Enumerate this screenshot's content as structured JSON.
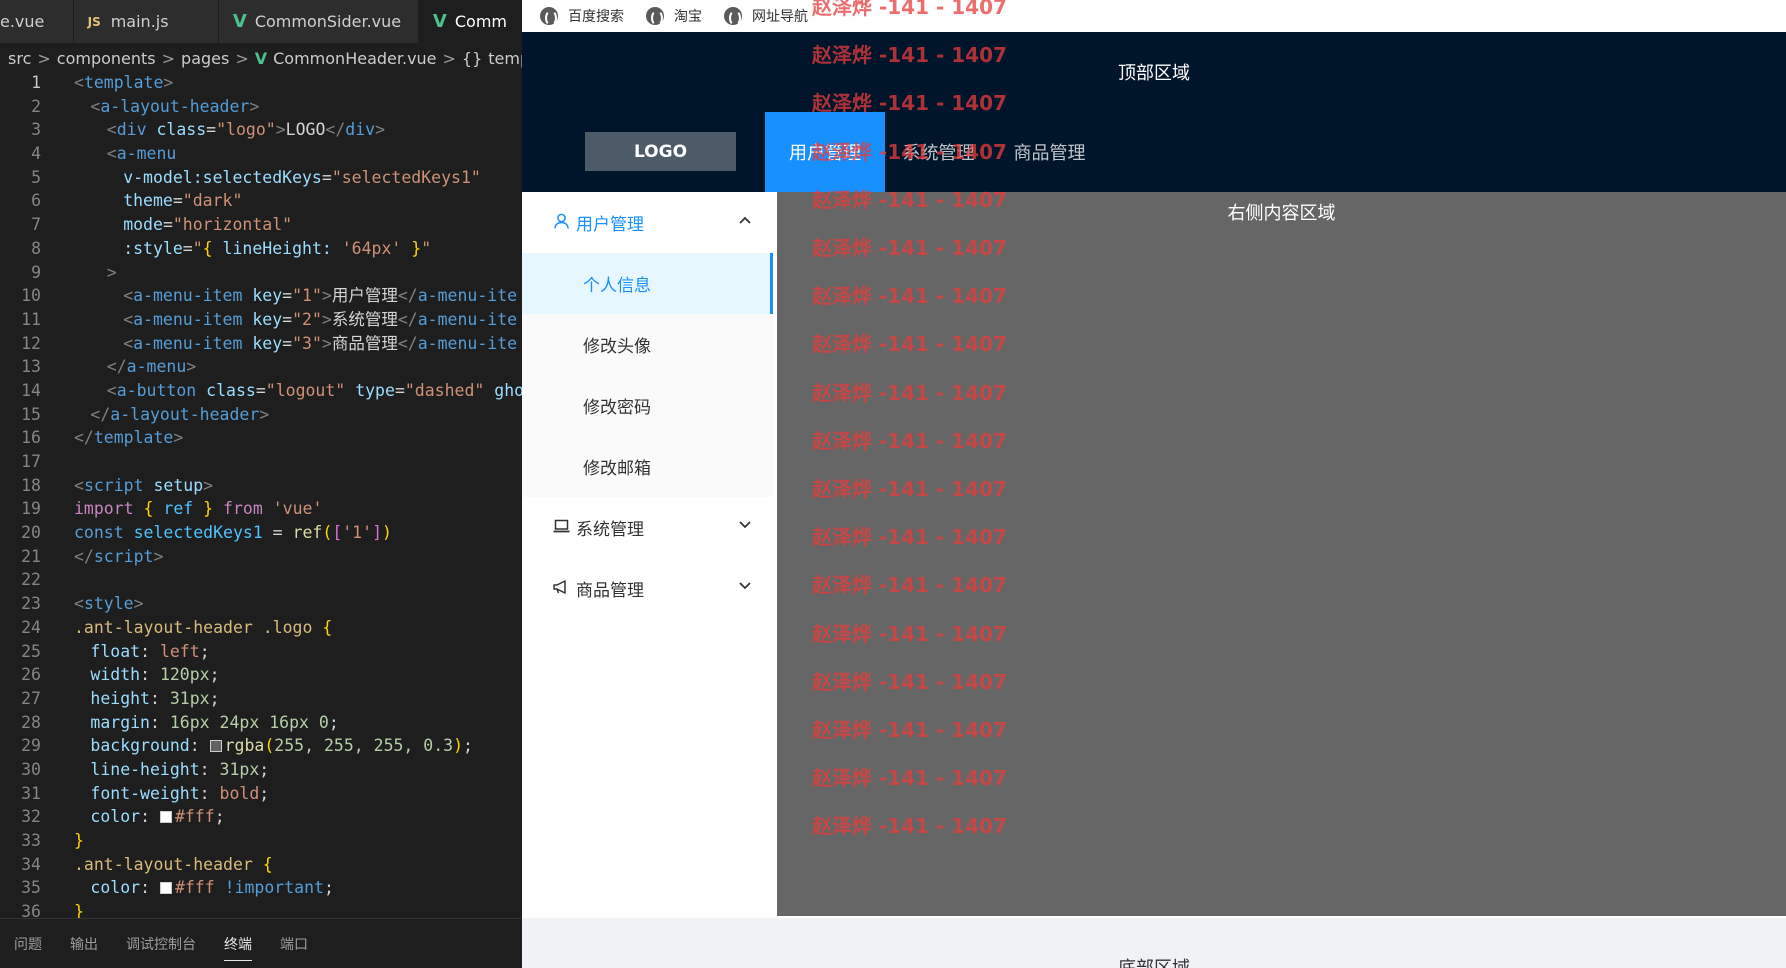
{
  "editor": {
    "tabs": [
      {
        "label": "e.vue",
        "kind": "none"
      },
      {
        "label": "main.js",
        "kind": "js"
      },
      {
        "label": "CommonSider.vue",
        "kind": "vue"
      },
      {
        "label": "Comm",
        "kind": "vue"
      }
    ],
    "tab_js_badge": "JS",
    "tab_vue_glyph": "V",
    "breadcrumb": {
      "src": "src",
      "components": "components",
      "pages": "pages",
      "file": "CommonHeader.vue",
      "symbol_icon": "{}",
      "symbol": "template",
      "sep": ">"
    },
    "lines": [
      {
        "n": "1"
      },
      {
        "n": "2"
      },
      {
        "n": "3"
      },
      {
        "n": "4"
      },
      {
        "n": "5"
      },
      {
        "n": "6"
      },
      {
        "n": "7"
      },
      {
        "n": "8"
      },
      {
        "n": "9"
      },
      {
        "n": "10"
      },
      {
        "n": "11"
      },
      {
        "n": "12"
      },
      {
        "n": "13"
      },
      {
        "n": "14"
      },
      {
        "n": "15"
      },
      {
        "n": "16"
      },
      {
        "n": "17"
      },
      {
        "n": "18"
      },
      {
        "n": "19"
      },
      {
        "n": "20"
      },
      {
        "n": "21"
      },
      {
        "n": "22"
      },
      {
        "n": "23"
      },
      {
        "n": "24"
      },
      {
        "n": "25"
      },
      {
        "n": "26"
      },
      {
        "n": "27"
      },
      {
        "n": "28"
      },
      {
        "n": "29"
      },
      {
        "n": "30"
      },
      {
        "n": "31"
      },
      {
        "n": "32"
      },
      {
        "n": "33"
      },
      {
        "n": "34"
      },
      {
        "n": "35"
      },
      {
        "n": "36"
      }
    ],
    "code": {
      "l1": [
        "<",
        "template",
        ">"
      ],
      "l2": [
        "<",
        "a-layout-header",
        ">"
      ],
      "l3": [
        "<",
        "div",
        " ",
        "class",
        "=",
        "\"logo\"",
        ">",
        "LOGO",
        "</",
        "div",
        ">"
      ],
      "l4": [
        "<",
        "a-menu"
      ],
      "l5": [
        "v-model:selectedKeys",
        "=",
        "\"selectedKeys1\""
      ],
      "l6": [
        "theme",
        "=",
        "\"dark\""
      ],
      "l7": [
        "mode",
        "=",
        "\"horizontal\""
      ],
      "l8": [
        ":style",
        "=",
        "\"",
        "{",
        " lineHeight: ",
        "'64px'",
        " ",
        "}",
        "\""
      ],
      "l9": [
        ">"
      ],
      "l10": [
        "<",
        "a-menu-item",
        " ",
        "key",
        "=",
        "\"1\"",
        ">",
        "用户管理",
        "</",
        "a-menu-ite"
      ],
      "l11": [
        "<",
        "a-menu-item",
        " ",
        "key",
        "=",
        "\"2\"",
        ">",
        "系统管理",
        "</",
        "a-menu-ite"
      ],
      "l12": [
        "<",
        "a-menu-item",
        " ",
        "key",
        "=",
        "\"3\"",
        ">",
        "商品管理",
        "</",
        "a-menu-ite"
      ],
      "l13": [
        "</",
        "a-menu",
        ">"
      ],
      "l14": [
        "<",
        "a-button",
        " ",
        "class",
        "=",
        "\"logout\"",
        " ",
        "type",
        "=",
        "\"dashed\"",
        " ",
        "ghos"
      ],
      "l15": [
        "</",
        "a-layout-header",
        ">"
      ],
      "l16": [
        "</",
        "template",
        ">"
      ],
      "l18": [
        "<",
        "script",
        " ",
        "setup",
        ">"
      ],
      "l19": [
        "import",
        " ",
        "{",
        " ",
        "ref",
        " ",
        "}",
        " ",
        "from",
        " ",
        "'vue'"
      ],
      "l20": [
        "const",
        " ",
        "selectedKeys1",
        " = ",
        "ref",
        "(",
        "[",
        "'1'",
        "]",
        ")"
      ],
      "l21": [
        "</",
        "script",
        ">"
      ],
      "l23": [
        "<",
        "style",
        ">"
      ],
      "l24": [
        ".ant-layout-header",
        " ",
        ".logo",
        " ",
        "{"
      ],
      "l25": [
        "float",
        ": ",
        "left",
        ";"
      ],
      "l26": [
        "width",
        ": ",
        "120px",
        ";"
      ],
      "l27": [
        "height",
        ": ",
        "31px",
        ";"
      ],
      "l28": [
        "margin",
        ": ",
        "16px 24px 16px 0",
        ";"
      ],
      "l29": [
        "background",
        ": ",
        "rgba",
        "(",
        "255, 255, 255, 0.3",
        ")",
        ";"
      ],
      "l30": [
        "line-height",
        ": ",
        "31px",
        ";"
      ],
      "l31": [
        "font-weight",
        ": ",
        "bold",
        ";"
      ],
      "l32": [
        "color",
        ": ",
        "#fff",
        ";"
      ],
      "l33": [
        "}"
      ],
      "l34": [
        ".ant-layout-header",
        " ",
        "{"
      ],
      "l35": [
        "color",
        ": ",
        "#fff",
        " ",
        "!important",
        ";"
      ],
      "l36": [
        "}"
      ]
    },
    "panel_tabs": [
      "问题",
      "输出",
      "调试控制台",
      "终端",
      "端口"
    ],
    "panel_active_index": 3
  },
  "browser": {
    "bookmarks": [
      {
        "label": "百度搜索",
        "icon": "globe-icon"
      },
      {
        "label": "淘宝",
        "icon": "globe-icon"
      },
      {
        "label": "网址导航",
        "icon": "globe-icon"
      }
    ]
  },
  "app": {
    "header_title": "顶部区域",
    "logo": "LOGO",
    "top_menu": [
      "用户管理",
      "系统管理",
      "商品管理"
    ],
    "top_menu_active": 0,
    "sider": {
      "user_mgmt": "用户管理",
      "user_items": [
        "个人信息",
        "修改头像",
        "修改密码",
        "修改邮箱"
      ],
      "selected_index": 0,
      "system_mgmt": "系统管理",
      "goods_mgmt": "商品管理"
    },
    "content_title": "右侧内容区域",
    "footer_title": "底部区域",
    "watermark": "赵泽烨 -141 - 1407",
    "watermark_count": 18
  },
  "colors": {
    "header_bg": "#001529",
    "menu_active": "#1890ff",
    "content_bg": "#666666",
    "footer_bg": "#f0f2f5",
    "watermark": "#e63c3c",
    "editor_bg": "#1e1e1e"
  }
}
